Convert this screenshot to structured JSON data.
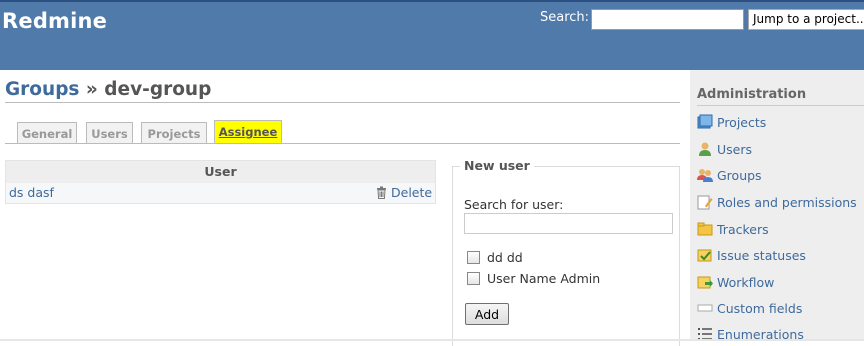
{
  "header": {
    "app_title": "Redmine",
    "search_label": "Search:",
    "search_value": "",
    "jump_label": "Jump to a project..."
  },
  "page": {
    "breadcrumb_link": "Groups",
    "breadcrumb_sep": " » ",
    "current": "dev-group"
  },
  "tabs": [
    {
      "label": "General",
      "selected": false
    },
    {
      "label": "Users",
      "selected": false
    },
    {
      "label": "Projects",
      "selected": false
    },
    {
      "label": "Assignee",
      "selected": true
    }
  ],
  "members": {
    "column_header": "User",
    "rows": [
      {
        "user": "ds dasf",
        "action": "Delete"
      }
    ]
  },
  "new_user": {
    "legend": "New user",
    "search_label": "Search for user:",
    "search_value": "",
    "candidates": [
      {
        "name": "dd dd",
        "checked": false
      },
      {
        "name": "User Name Admin",
        "checked": false
      }
    ],
    "add_label": "Add"
  },
  "sidebar": {
    "title": "Administration",
    "items": [
      {
        "label": "Projects",
        "icon": "projects-icon"
      },
      {
        "label": "Users",
        "icon": "user-icon"
      },
      {
        "label": "Groups",
        "icon": "group-icon"
      },
      {
        "label": "Roles and permissions",
        "icon": "roles-icon"
      },
      {
        "label": "Trackers",
        "icon": "tracker-icon"
      },
      {
        "label": "Issue statuses",
        "icon": "issue-status-icon"
      },
      {
        "label": "Workflow",
        "icon": "workflow-icon"
      },
      {
        "label": "Custom fields",
        "icon": "custom-fields-icon"
      },
      {
        "label": "Enumerations",
        "icon": "list-icon"
      }
    ]
  },
  "colors": {
    "header_bg": "#507aaa",
    "link": "#3e6a9c",
    "selected_tab_bg": "#ffff00",
    "sidebar_bg": "#eeeeee"
  }
}
